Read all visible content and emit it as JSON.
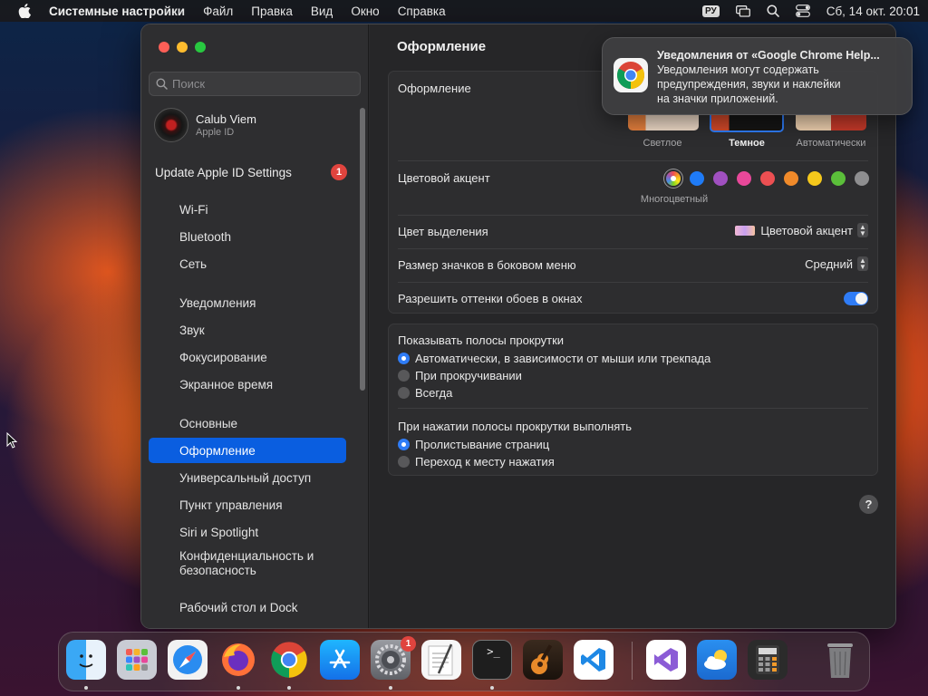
{
  "menubar": {
    "app_name": "Системные настройки",
    "menus": [
      "Файл",
      "Правка",
      "Вид",
      "Окно",
      "Справка"
    ],
    "input_source": "РУ",
    "datetime": "Сб, 14 окт.  20:01"
  },
  "sidebar": {
    "search_placeholder": "Поиск",
    "profile_name": "Calub Viem",
    "profile_sub": "Apple ID",
    "update_label": "Update Apple ID Settings",
    "update_badge": "1",
    "items": [
      {
        "label": "Wi-Fi"
      },
      {
        "label": "Bluetooth"
      },
      {
        "label": "Сеть"
      },
      {
        "label": "Уведомления"
      },
      {
        "label": "Звук"
      },
      {
        "label": "Фокусирование"
      },
      {
        "label": "Экранное время"
      },
      {
        "label": "Основные"
      },
      {
        "label": "Оформление"
      },
      {
        "label": "Универсальный доступ"
      },
      {
        "label": "Пункт управления"
      },
      {
        "label": "Siri и Spotlight"
      },
      {
        "label": "Конфиденциальность и безопасность"
      },
      {
        "label": "Рабочий стол и Dock"
      }
    ],
    "selected": "Оформление"
  },
  "content": {
    "title": "Оформление",
    "appearance_label": "Оформление",
    "appearance_options": [
      "Светлое",
      "Темное",
      "Автоматически"
    ],
    "appearance_selected": "Темное",
    "accent_label": "Цветовой акцент",
    "accent_caption": "Многоцветный",
    "accent_colors": [
      "multicolor",
      "#1f7bf6",
      "#a050c0",
      "#e8489a",
      "#ec4f52",
      "#f08a2a",
      "#f5c81c",
      "#5bbf3a",
      "#8e8e90"
    ],
    "highlight_label": "Цвет выделения",
    "highlight_value": "Цветовой акцент",
    "icon_size_label": "Размер значков в боковом меню",
    "icon_size_value": "Средний",
    "tinting_label": "Разрешить оттенки обоев в окнах",
    "tinting_on": true,
    "scrollbars_label": "Показывать полосы прокрутки",
    "scrollbars_options": [
      {
        "label": "Автоматически, в зависимости от мыши или трекпада",
        "selected": true
      },
      {
        "label": "При прокручивании",
        "selected": false
      },
      {
        "label": "Всегда",
        "selected": false
      }
    ],
    "click_label": "При нажатии полосы прокрутки выполнять",
    "click_options": [
      {
        "label": "Пролистывание страниц",
        "selected": true
      },
      {
        "label": "Переход к месту нажатия",
        "selected": false
      }
    ],
    "help": "?"
  },
  "notification": {
    "title": "Уведомления от «Google Chrome Help...",
    "body_line1": "Уведомления могут содержать",
    "body_line2": "предупреждения, звуки и наклейки",
    "body_line3": "на значки приложений."
  },
  "dock": {
    "apps": [
      "Finder",
      "Launchpad",
      "Safari",
      "Firefox",
      "Google Chrome",
      "App Store",
      "Системные настройки",
      "TextEdit",
      "Терминал",
      "GarageBand",
      "Visual Studio Code",
      "Visual Studio",
      "Погода",
      "Калькулятор",
      "Корзина"
    ],
    "settings_badge": "1"
  }
}
